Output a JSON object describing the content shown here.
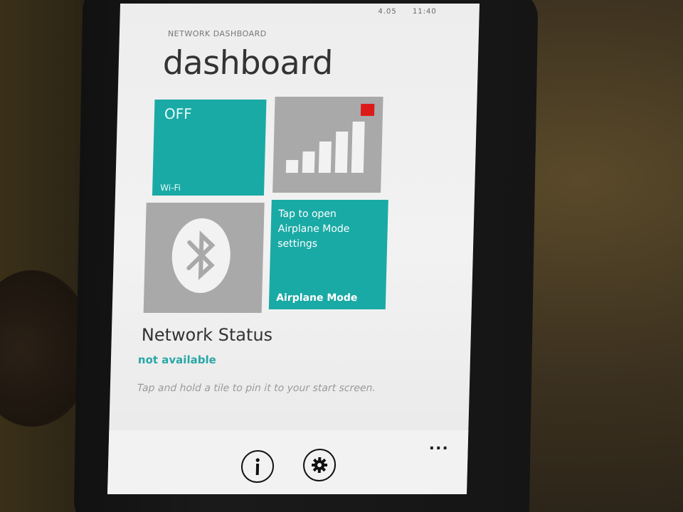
{
  "status": {
    "signal": "4.05",
    "time": "11:40"
  },
  "app": {
    "title": "NETWORK DASHBOARD",
    "page": "dashboard"
  },
  "tiles": {
    "wifi": {
      "state": "OFF",
      "name": "Wi-Fi",
      "color": "#1aaaa5"
    },
    "signal": {
      "bars": 5,
      "alert_color": "#dd1a1a",
      "icon": "cellular-signal-icon"
    },
    "bluetooth": {
      "icon": "bluetooth-icon"
    },
    "airplane": {
      "description": "Tap to open Airplane Mode settings",
      "name": "Airplane Mode",
      "color": "#1aaaa5"
    }
  },
  "network_status": {
    "label": "Network Status",
    "value": "not available"
  },
  "hint": "Tap and hold a tile to pin it to your start screen.",
  "app_bar": {
    "info_icon": "info-icon",
    "settings_icon": "gear-icon",
    "more_label": "..."
  }
}
